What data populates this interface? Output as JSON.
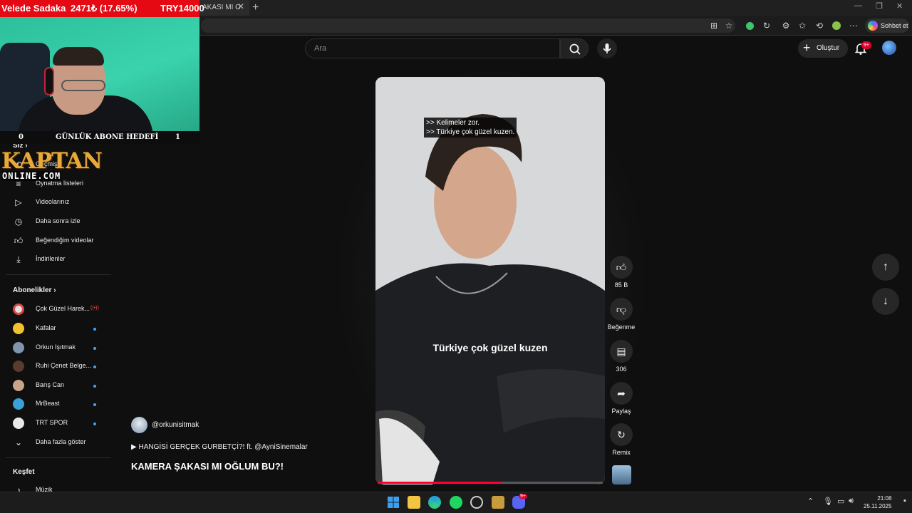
{
  "browser": {
    "tab_title": "AKASI MI O",
    "new_tab": "+",
    "tab_close": "✕",
    "window_controls": [
      "—",
      "❐",
      "✕"
    ],
    "copilot_label": "Sohbet et"
  },
  "header": {
    "search_placeholder": "Ara",
    "create_label": "Oluştur",
    "notifications_badge": "9+"
  },
  "sidebar": {
    "you_heading": "Siz",
    "you_items": [
      {
        "label": "Geçmiş",
        "icon": "history-icon"
      },
      {
        "label": "Oynatma listeleri",
        "icon": "playlist-icon"
      },
      {
        "label": "Videolarınız",
        "icon": "video-icon"
      },
      {
        "label": "Daha sonra izle",
        "icon": "clock-icon"
      },
      {
        "label": "Beğendiğim videolar",
        "icon": "thumbs-up-icon"
      },
      {
        "label": "İndirilenler",
        "icon": "download-icon"
      }
    ],
    "subs_heading": "Abonelikler",
    "subscriptions": [
      {
        "label": "Çok Güzel Harek...",
        "live": "((•))",
        "color": "#d94a4a"
      },
      {
        "label": "Kafalar",
        "color": "#f2c12e"
      },
      {
        "label": "Orkun Işıtmak",
        "color": "#7f95ad"
      },
      {
        "label": "Ruhi Çenet Belge...",
        "color": "#5a3b2e"
      },
      {
        "label": "Barış Can",
        "color": "#c9a38a"
      },
      {
        "label": "MrBeast",
        "color": "#3aa0d8"
      },
      {
        "label": "TRT SPOR",
        "color": "#e8e8e8"
      }
    ],
    "show_more": "Daha fazla göster",
    "explore_heading": "Keşfet",
    "explore_first": "Müzik"
  },
  "video": {
    "caption_line1": ">> Kelimeler zor.",
    "caption_line2": ">> Türkiye çok güzel kuzen.",
    "subtitle": "Türkiye çok güzel kuzen",
    "progress": 0.55,
    "channel": "@orkunisitmak",
    "song": "▶ HANGİSİ GERÇEK GURBETÇİ?! ft. @AyniSinemalar",
    "title": "KAMERA ŞAKASI MI OĞLUM BU?!"
  },
  "actions": {
    "like_count": "85 B",
    "dislike_label": "Beğenme",
    "comment_count": "306",
    "share_label": "Paylaş",
    "remix_label": "Remix"
  },
  "overlay": {
    "donor": "Velede Sadaka",
    "amount": "2471₺ (17.65%)",
    "goal": "TRY14000",
    "goal_start": "0",
    "goal_label": "GÜNLÜK ABONE HEDEFİ",
    "goal_end": "1",
    "logo_top": "KAPTAN",
    "logo_bottom": "ONLINE.COM"
  },
  "taskbar": {
    "time": "21:08",
    "date": "25.11.2025",
    "discord_badge": "9+"
  },
  "colors": {
    "youtube_red": "#ff0033",
    "overlay_red": "#e50914",
    "logo_gold": "#e8a83a"
  }
}
